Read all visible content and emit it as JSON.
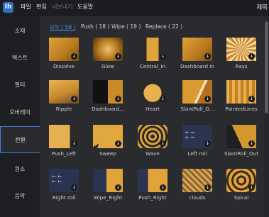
{
  "menubar": {
    "logo": "Ih",
    "items": [
      {
        "label": "파일",
        "enabled": true
      },
      {
        "label": "편집",
        "enabled": true
      },
      {
        "label": "내보내기",
        "enabled": false
      },
      {
        "label": "도움말",
        "enabled": true
      }
    ],
    "title": "제목"
  },
  "sidebar": {
    "items": [
      {
        "label": "소재",
        "active": false
      },
      {
        "label": "텍스트",
        "active": false
      },
      {
        "label": "필터",
        "active": false
      },
      {
        "label": "오버레이",
        "active": false
      },
      {
        "label": "전환",
        "active": true
      },
      {
        "label": "원소",
        "active": false
      },
      {
        "label": "음악",
        "active": false
      }
    ]
  },
  "tabs": [
    {
      "label": "모두 ( 59 )",
      "active": true
    },
    {
      "label": "Push ( 18 )",
      "active": false
    },
    {
      "label": "Wipe ( 19 )",
      "active": false
    },
    {
      "label": "Replace ( 22 )",
      "active": false
    }
  ],
  "transitions": [
    {
      "name": "Dissolve",
      "style": "warm"
    },
    {
      "name": "Glow",
      "style": "blur"
    },
    {
      "name": "Central_In",
      "style": "central"
    },
    {
      "name": "Dashboard In",
      "style": "warm"
    },
    {
      "name": "Rays",
      "style": "rays"
    },
    {
      "name": "Ripple",
      "style": "cat"
    },
    {
      "name": "Dashboard...",
      "style": "dark"
    },
    {
      "name": "Heart",
      "style": "heart"
    },
    {
      "name": "SlantRoll_O...",
      "style": "slant"
    },
    {
      "name": "PaintedLines",
      "style": "painted"
    },
    {
      "name": "Push_Left",
      "style": "pushleft"
    },
    {
      "name": "Sweep",
      "style": "sweep"
    },
    {
      "name": "Wave",
      "style": "wave"
    },
    {
      "name": "Left roll",
      "style": "roll"
    },
    {
      "name": "SlantRoll_Out",
      "style": "slant2"
    },
    {
      "name": "Right roll",
      "style": "roll"
    },
    {
      "name": "Wipe_Right",
      "style": "wiperight"
    },
    {
      "name": "Push_Right",
      "style": "pushright"
    },
    {
      "name": "clouds",
      "style": "clouds"
    },
    {
      "name": "Spiral",
      "style": "spiral"
    }
  ],
  "colors": {
    "accent": "#3f7fd6",
    "tab_active": "#4a92f0",
    "warm": "#d79a2b",
    "navy": "#2a3350"
  },
  "icons": {
    "download": "download-icon"
  }
}
